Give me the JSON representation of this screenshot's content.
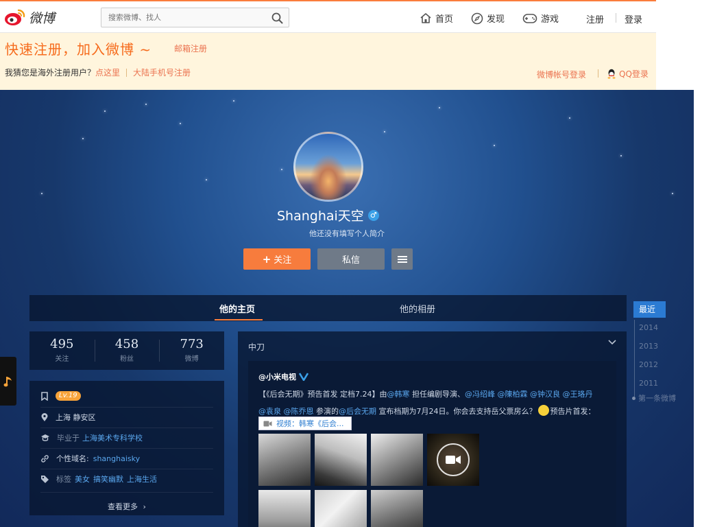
{
  "topnav": {
    "logo_text": "微博",
    "search_placeholder": "搜索微博、找人",
    "links": [
      {
        "label": "首页",
        "icon": "home-icon"
      },
      {
        "label": "发现",
        "icon": "compass-icon"
      },
      {
        "label": "游戏",
        "icon": "gamepad-icon"
      }
    ],
    "register": "注册",
    "login": "登录",
    "accent_color": "#fa7d3c"
  },
  "register_bar": {
    "slogan": "快速注册，加入微博 ~",
    "email_register": "邮箱注册",
    "overseas_prompt": "我猜您是海外注册用户？",
    "click_here": "点这里",
    "mainland_register": "大陆手机号注册",
    "weibo_login": "微博帐号登录",
    "qq_login": "QQ登录"
  },
  "profile": {
    "name": "Shanghai天空",
    "gender_symbol": "♂",
    "bio": "他还没有填写个人简介",
    "follow_button": "关注",
    "message_button": "私信"
  },
  "tabs": {
    "home": "他的主页",
    "album": "他的相册"
  },
  "timeline": {
    "recent": "最近",
    "years": [
      "2014",
      "2013",
      "2012",
      "2011"
    ],
    "first": "第一条微博"
  },
  "stats": [
    {
      "value": "495",
      "label": "关注"
    },
    {
      "value": "458",
      "label": "粉丝"
    },
    {
      "value": "773",
      "label": "微博"
    }
  ],
  "info": {
    "level": "Lv.19",
    "location": "上海 静安区",
    "school_prefix": "毕业于",
    "school": "上海美术专科学校",
    "domain_label": "个性域名:",
    "domain": "shanghaisky",
    "tags_label": "标签",
    "tags": [
      "美女",
      "搞笑幽默",
      "上海生活"
    ],
    "more": "查看更多"
  },
  "feed": {
    "header": "中刀",
    "post": {
      "author": "@小米电视",
      "text_1": "【《后会无期》预告首发 定档7.24】由",
      "m_hanhan": "@韩寒",
      "text_2": " 担任编剧导演、",
      "m_feng": "@冯绍峰",
      "m_chen": "@陳柏霖",
      "m_zhong": "@钟汉良",
      "m_wang": "@王珞丹",
      "m_yuan": "@袁泉",
      "m_qiao": "@陈乔恩",
      "text_3": " 参演的",
      "m_movie": "@后会无期",
      "text_4": " 宣布档期为7月24日。你会去支持岳父票房么？",
      "text_5": "预告片首发：",
      "video_label": "视频：韩寒《后会..."
    }
  }
}
